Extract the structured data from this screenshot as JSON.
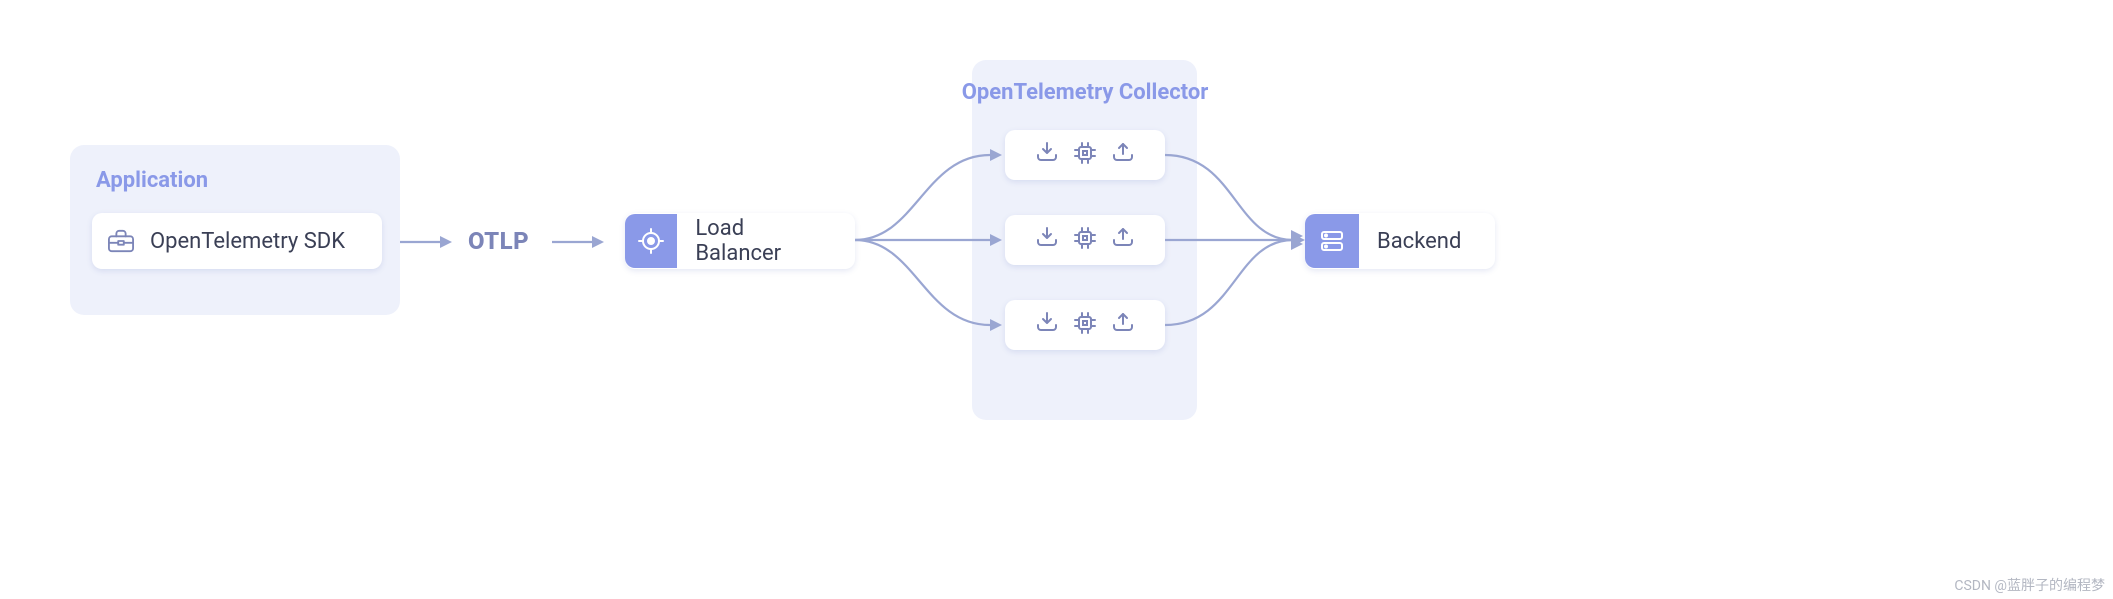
{
  "application": {
    "panel_title": "Application",
    "sdk_label": "OpenTelemetry SDK"
  },
  "protocol_label": "OTLP",
  "load_balancer_label": "Load Balancer",
  "collector": {
    "panel_title": "OpenTelemetry Collector",
    "pipeline_icons": [
      "receive-icon",
      "process-icon",
      "export-icon"
    ]
  },
  "backend_label": "Backend",
  "footer": "CSDN @蓝胖子的编程梦",
  "colors": {
    "panel_bg": "#eef1fb",
    "accent": "#8a99e8",
    "stroke": "#9aa6d2"
  }
}
